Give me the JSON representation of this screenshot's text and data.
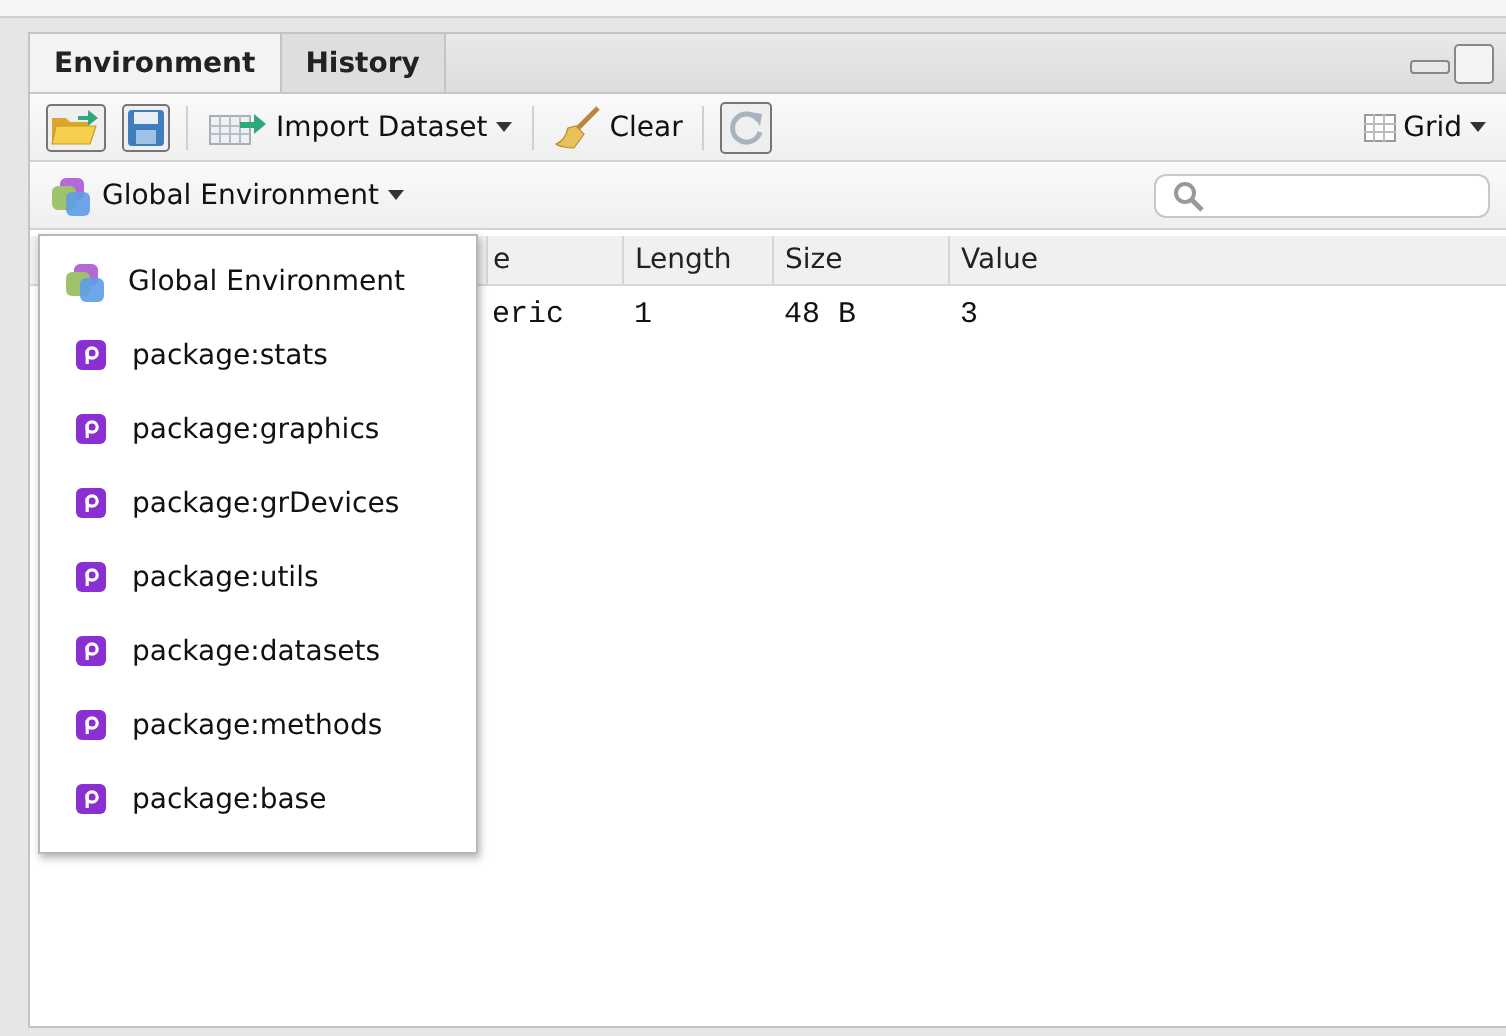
{
  "tabs": [
    {
      "label": "Environment",
      "selected": true
    },
    {
      "label": "History",
      "selected": false
    }
  ],
  "toolbar": {
    "import_button": "Import Dataset",
    "clear_button": "Clear",
    "view_button": "Grid"
  },
  "environment_selector": {
    "label": "Global Environment"
  },
  "table": {
    "columns": [
      {
        "label": "e"
      },
      {
        "label": "Length"
      },
      {
        "label": "Size"
      },
      {
        "label": "Value"
      }
    ],
    "rows": [
      {
        "cells": [
          "eric",
          "1",
          "48 B",
          "3"
        ]
      }
    ]
  },
  "environment_menu": {
    "items": [
      {
        "kind": "global",
        "label": "Global Environment"
      },
      {
        "kind": "package",
        "label": "package:stats"
      },
      {
        "kind": "package",
        "label": "package:graphics"
      },
      {
        "kind": "package",
        "label": "package:grDevices"
      },
      {
        "kind": "package",
        "label": "package:utils"
      },
      {
        "kind": "package",
        "label": "package:datasets"
      },
      {
        "kind": "package",
        "label": "package:methods"
      },
      {
        "kind": "package",
        "label": "package:base"
      }
    ]
  }
}
